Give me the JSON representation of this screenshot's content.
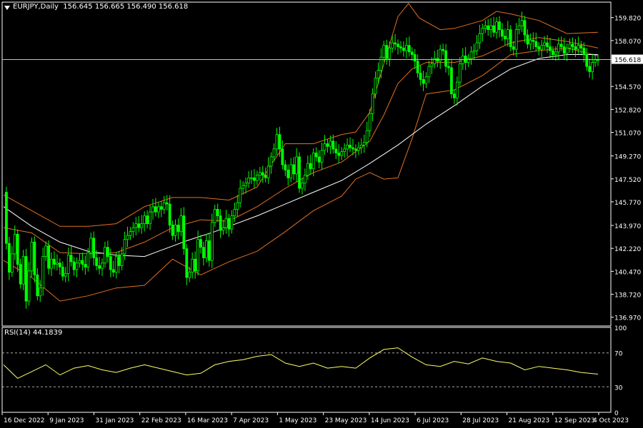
{
  "header": {
    "symbol": "EURJPY,Daily",
    "ohlc": "156.645 156.665 156.490 156.618"
  },
  "rsi_header": "RSI(14) 44.1839",
  "colors": {
    "background": "#000000",
    "bull_candle": "#00ff00",
    "bear_candle": "#00ff00",
    "bollinger": "#e07020",
    "moving_average": "#ffffff",
    "rsi_line": "#ffff66",
    "axis_text": "#ffffff",
    "price_line": "#c0c0c0"
  },
  "icons": {
    "collapse": "triangle-down-icon"
  },
  "chart_data": [
    {
      "type": "candlestick",
      "title": "EURJPY,Daily",
      "ylim": [
        136.3,
        161.0
      ],
      "y_ticks": [
        "159.820",
        "158.070",
        "156.618",
        "154.570",
        "152.820",
        "151.070",
        "149.270",
        "147.520",
        "145.770",
        "143.970",
        "142.220",
        "140.470",
        "138.720",
        "136.970"
      ],
      "current_price": "156.618",
      "x_labels": [
        "16 Dec 2022",
        "9 Jan 2023",
        "31 Jan 2023",
        "22 Feb 2023",
        "16 Mar 2023",
        "7 Apr 2023",
        "1 May 2023",
        "23 May 2023",
        "14 Jun 2023",
        "6 Jul 2023",
        "28 Jul 2023",
        "21 Aug 2023",
        "12 Sep 2023",
        "4 Oct 2023"
      ],
      "close_series": [
        [
          0,
          146.5
        ],
        [
          4,
          142.6
        ],
        [
          8,
          140.4
        ],
        [
          12,
          141.8
        ],
        [
          16,
          143.3
        ],
        [
          20,
          141.0
        ],
        [
          24,
          139.5
        ],
        [
          28,
          141.6
        ],
        [
          32,
          138.2
        ],
        [
          36,
          140.5
        ],
        [
          40,
          142.7
        ],
        [
          44,
          140.2
        ],
        [
          48,
          138.6
        ],
        [
          52,
          139.2
        ],
        [
          56,
          141.6
        ],
        [
          60,
          142.4
        ],
        [
          64,
          140.7
        ],
        [
          68,
          141.4
        ],
        [
          72,
          141.0
        ],
        [
          76,
          141.1
        ],
        [
          80,
          140.8
        ],
        [
          84,
          140.1
        ],
        [
          88,
          140.3
        ],
        [
          92,
          141.7
        ],
        [
          96,
          141.2
        ],
        [
          100,
          140.6
        ],
        [
          104,
          141.1
        ],
        [
          108,
          141.3
        ],
        [
          112,
          141.0
        ],
        [
          116,
          140.8
        ],
        [
          120,
          141.9
        ],
        [
          124,
          143.0
        ],
        [
          128,
          141.5
        ],
        [
          132,
          140.9
        ],
        [
          136,
          140.7
        ],
        [
          140,
          141.1
        ],
        [
          144,
          142.3
        ],
        [
          148,
          141.6
        ],
        [
          152,
          140.6
        ],
        [
          156,
          140.4
        ],
        [
          160,
          141.6
        ],
        [
          164,
          140.9
        ],
        [
          168,
          141.8
        ],
        [
          172,
          142.9
        ],
        [
          176,
          143.2
        ],
        [
          180,
          143.5
        ],
        [
          184,
          143.8
        ],
        [
          188,
          144.1
        ],
        [
          192,
          143.8
        ],
        [
          196,
          144.1
        ],
        [
          200,
          144.7
        ],
        [
          204,
          144.1
        ],
        [
          208,
          145.0
        ],
        [
          212,
          145.4
        ],
        [
          216,
          145.0
        ],
        [
          220,
          145.4
        ],
        [
          224,
          145.2
        ],
        [
          228,
          145.7
        ],
        [
          232,
          145.6
        ],
        [
          236,
          144.0
        ],
        [
          240,
          143.2
        ],
        [
          244,
          144.0
        ],
        [
          248,
          143.5
        ],
        [
          252,
          144.7
        ],
        [
          256,
          142.2
        ],
        [
          260,
          140.0
        ],
        [
          264,
          140.4
        ],
        [
          268,
          141.4
        ],
        [
          272,
          140.5
        ],
        [
          276,
          142.9
        ],
        [
          280,
          142.3
        ],
        [
          284,
          141.5
        ],
        [
          288,
          142.8
        ],
        [
          292,
          141.3
        ],
        [
          296,
          144.2
        ],
        [
          300,
          145.2
        ],
        [
          304,
          144.7
        ],
        [
          308,
          143.6
        ],
        [
          312,
          143.8
        ],
        [
          316,
          144.5
        ],
        [
          320,
          143.7
        ],
        [
          324,
          144.7
        ],
        [
          328,
          145.2
        ],
        [
          332,
          145.7
        ],
        [
          336,
          146.8
        ],
        [
          340,
          147.0
        ],
        [
          344,
          147.2
        ],
        [
          348,
          147.6
        ],
        [
          352,
          147.6
        ],
        [
          356,
          147.4
        ],
        [
          360,
          147.8
        ],
        [
          364,
          148.0
        ],
        [
          368,
          147.8
        ],
        [
          372,
          147.6
        ],
        [
          376,
          148.5
        ],
        [
          380,
          149.2
        ],
        [
          384,
          149.8
        ],
        [
          388,
          150.9
        ],
        [
          392,
          149.8
        ],
        [
          396,
          148.6
        ],
        [
          400,
          148.2
        ],
        [
          404,
          147.6
        ],
        [
          408,
          148.6
        ],
        [
          412,
          147.9
        ],
        [
          416,
          149.2
        ],
        [
          420,
          146.8
        ],
        [
          424,
          147.2
        ],
        [
          428,
          147.8
        ],
        [
          432,
          148.7
        ],
        [
          436,
          148.3
        ],
        [
          440,
          149.5
        ],
        [
          444,
          149.2
        ],
        [
          448,
          148.8
        ],
        [
          452,
          149.7
        ],
        [
          456,
          150.2
        ],
        [
          460,
          150.0
        ],
        [
          464,
          150.4
        ],
        [
          468,
          149.8
        ],
        [
          472,
          149.5
        ],
        [
          476,
          149.3
        ],
        [
          480,
          149.6
        ],
        [
          484,
          149.8
        ],
        [
          488,
          150.1
        ],
        [
          492,
          149.9
        ],
        [
          496,
          149.8
        ],
        [
          500,
          149.7
        ],
        [
          504,
          149.9
        ],
        [
          508,
          150.1
        ],
        [
          512,
          150.3
        ],
        [
          516,
          151.2
        ],
        [
          520,
          152.5
        ],
        [
          524,
          154.0
        ],
        [
          528,
          155.2
        ],
        [
          532,
          155.8
        ],
        [
          536,
          156.8
        ],
        [
          540,
          157.7
        ],
        [
          544,
          156.7
        ],
        [
          548,
          157.5
        ],
        [
          552,
          157.9
        ],
        [
          556,
          157.8
        ],
        [
          560,
          157.6
        ],
        [
          564,
          157.5
        ],
        [
          568,
          157.3
        ],
        [
          572,
          157.7
        ],
        [
          576,
          157.2
        ],
        [
          580,
          157.0
        ],
        [
          584,
          156.5
        ],
        [
          588,
          155.6
        ],
        [
          592,
          155.1
        ],
        [
          596,
          154.8
        ],
        [
          600,
          155.3
        ],
        [
          604,
          156.1
        ],
        [
          608,
          156.3
        ],
        [
          612,
          156.7
        ],
        [
          616,
          156.5
        ],
        [
          620,
          157.4
        ],
        [
          624,
          157.3
        ],
        [
          628,
          156.1
        ],
        [
          632,
          156.0
        ],
        [
          636,
          154.0
        ],
        [
          640,
          153.7
        ],
        [
          644,
          154.9
        ],
        [
          648,
          156.3
        ],
        [
          652,
          156.9
        ],
        [
          656,
          156.4
        ],
        [
          660,
          156.7
        ],
        [
          664,
          157.2
        ],
        [
          668,
          157.3
        ],
        [
          672,
          157.9
        ],
        [
          676,
          158.6
        ],
        [
          680,
          159.0
        ],
        [
          684,
          159.2
        ],
        [
          688,
          158.9
        ],
        [
          692,
          159.2
        ],
        [
          696,
          158.7
        ],
        [
          700,
          159.5
        ],
        [
          704,
          158.9
        ],
        [
          708,
          158.4
        ],
        [
          712,
          158.2
        ],
        [
          716,
          158.9
        ],
        [
          720,
          157.6
        ],
        [
          724,
          157.4
        ],
        [
          728,
          158.9
        ],
        [
          732,
          159.2
        ],
        [
          736,
          159.6
        ],
        [
          740,
          158.5
        ],
        [
          744,
          157.8
        ],
        [
          748,
          158.1
        ],
        [
          752,
          158.0
        ],
        [
          756,
          157.6
        ],
        [
          760,
          157.4
        ],
        [
          764,
          157.7
        ],
        [
          768,
          157.9
        ],
        [
          772,
          157.6
        ],
        [
          776,
          157.3
        ],
        [
          780,
          157.0
        ],
        [
          784,
          157.2
        ],
        [
          788,
          157.8
        ],
        [
          792,
          157.6
        ],
        [
          796,
          157.1
        ],
        [
          800,
          157.5
        ],
        [
          804,
          157.8
        ],
        [
          808,
          157.6
        ],
        [
          812,
          157.4
        ],
        [
          816,
          157.7
        ],
        [
          820,
          157.5
        ],
        [
          824,
          157.0
        ],
        [
          828,
          156.1
        ],
        [
          832,
          155.7
        ],
        [
          836,
          156.4
        ],
        [
          840,
          156.6
        ],
        [
          844,
          156.6
        ]
      ],
      "ma_series": [
        [
          0,
          145.4
        ],
        [
          40,
          143.9
        ],
        [
          80,
          142.7
        ],
        [
          120,
          142.0
        ],
        [
          160,
          141.7
        ],
        [
          200,
          141.6
        ],
        [
          220,
          142.0
        ],
        [
          260,
          142.8
        ],
        [
          300,
          143.5
        ],
        [
          320,
          143.9
        ],
        [
          360,
          144.7
        ],
        [
          400,
          145.6
        ],
        [
          440,
          146.5
        ],
        [
          480,
          147.4
        ],
        [
          520,
          148.7
        ],
        [
          560,
          150.1
        ],
        [
          600,
          151.7
        ],
        [
          640,
          153.1
        ],
        [
          680,
          154.6
        ],
        [
          720,
          155.9
        ],
        [
          760,
          156.7
        ],
        [
          800,
          157.0
        ],
        [
          844,
          157.0
        ]
      ],
      "bollinger_upper": [
        [
          0,
          146.3
        ],
        [
          40,
          145.1
        ],
        [
          80,
          143.9
        ],
        [
          120,
          143.9
        ],
        [
          160,
          144.1
        ],
        [
          200,
          145.4
        ],
        [
          240,
          146.1
        ],
        [
          280,
          146.1
        ],
        [
          320,
          145.9
        ],
        [
          360,
          146.9
        ],
        [
          380,
          148.6
        ],
        [
          400,
          150.2
        ],
        [
          440,
          150.2
        ],
        [
          480,
          150.9
        ],
        [
          500,
          151.1
        ],
        [
          520,
          152.6
        ],
        [
          540,
          156.3
        ],
        [
          560,
          159.9
        ],
        [
          575,
          160.9
        ],
        [
          590,
          159.8
        ],
        [
          620,
          158.9
        ],
        [
          640,
          159.0
        ],
        [
          680,
          159.6
        ],
        [
          700,
          160.3
        ],
        [
          720,
          160.1
        ],
        [
          760,
          159.6
        ],
        [
          800,
          158.6
        ],
        [
          844,
          158.7
        ]
      ],
      "bollinger_middle": [
        [
          0,
          143.8
        ],
        [
          40,
          143.4
        ],
        [
          80,
          141.9
        ],
        [
          120,
          141.8
        ],
        [
          160,
          141.9
        ],
        [
          200,
          142.7
        ],
        [
          240,
          143.8
        ],
        [
          280,
          144.4
        ],
        [
          320,
          144.3
        ],
        [
          360,
          145.4
        ],
        [
          400,
          146.8
        ],
        [
          440,
          148.0
        ],
        [
          480,
          148.8
        ],
        [
          520,
          150.4
        ],
        [
          540,
          152.4
        ],
        [
          560,
          154.8
        ],
        [
          580,
          155.9
        ],
        [
          600,
          156.4
        ],
        [
          640,
          156.4
        ],
        [
          680,
          156.9
        ],
        [
          720,
          157.9
        ],
        [
          760,
          158.3
        ],
        [
          800,
          158.0
        ],
        [
          844,
          157.5
        ]
      ],
      "bollinger_lower": [
        [
          0,
          141.3
        ],
        [
          40,
          140.0
        ],
        [
          80,
          138.2
        ],
        [
          120,
          138.6
        ],
        [
          160,
          139.2
        ],
        [
          200,
          139.4
        ],
        [
          240,
          141.4
        ],
        [
          280,
          140.2
        ],
        [
          320,
          141.2
        ],
        [
          360,
          142.0
        ],
        [
          400,
          143.5
        ],
        [
          440,
          145.1
        ],
        [
          480,
          146.2
        ],
        [
          500,
          147.5
        ],
        [
          520,
          148.0
        ],
        [
          540,
          147.5
        ],
        [
          560,
          147.6
        ],
        [
          580,
          150.6
        ],
        [
          600,
          154.0
        ],
        [
          640,
          154.3
        ],
        [
          680,
          155.4
        ],
        [
          720,
          157.0
        ],
        [
          760,
          157.3
        ],
        [
          800,
          157.5
        ],
        [
          844,
          156.9
        ]
      ]
    },
    {
      "type": "line",
      "title": "RSI(14) 44.1839",
      "ylim": [
        0,
        100
      ],
      "y_ticks": [
        "100",
        "70",
        "30",
        "0"
      ],
      "levels": [
        70,
        30
      ],
      "x": [
        0,
        20,
        40,
        60,
        80,
        100,
        120,
        140,
        160,
        180,
        200,
        220,
        240,
        260,
        280,
        300,
        320,
        340,
        360,
        380,
        400,
        420,
        440,
        460,
        480,
        500,
        520,
        540,
        560,
        580,
        600,
        620,
        640,
        660,
        680,
        700,
        720,
        740,
        760,
        780,
        800,
        820,
        844
      ],
      "values": [
        56,
        40,
        48,
        56,
        44,
        52,
        55,
        50,
        47,
        52,
        56,
        52,
        48,
        44,
        46,
        56,
        60,
        62,
        66,
        68,
        58,
        54,
        58,
        52,
        54,
        52,
        64,
        74,
        76,
        65,
        56,
        54,
        60,
        57,
        64,
        60,
        58,
        50,
        54,
        52,
        50,
        47,
        45
      ]
    }
  ]
}
